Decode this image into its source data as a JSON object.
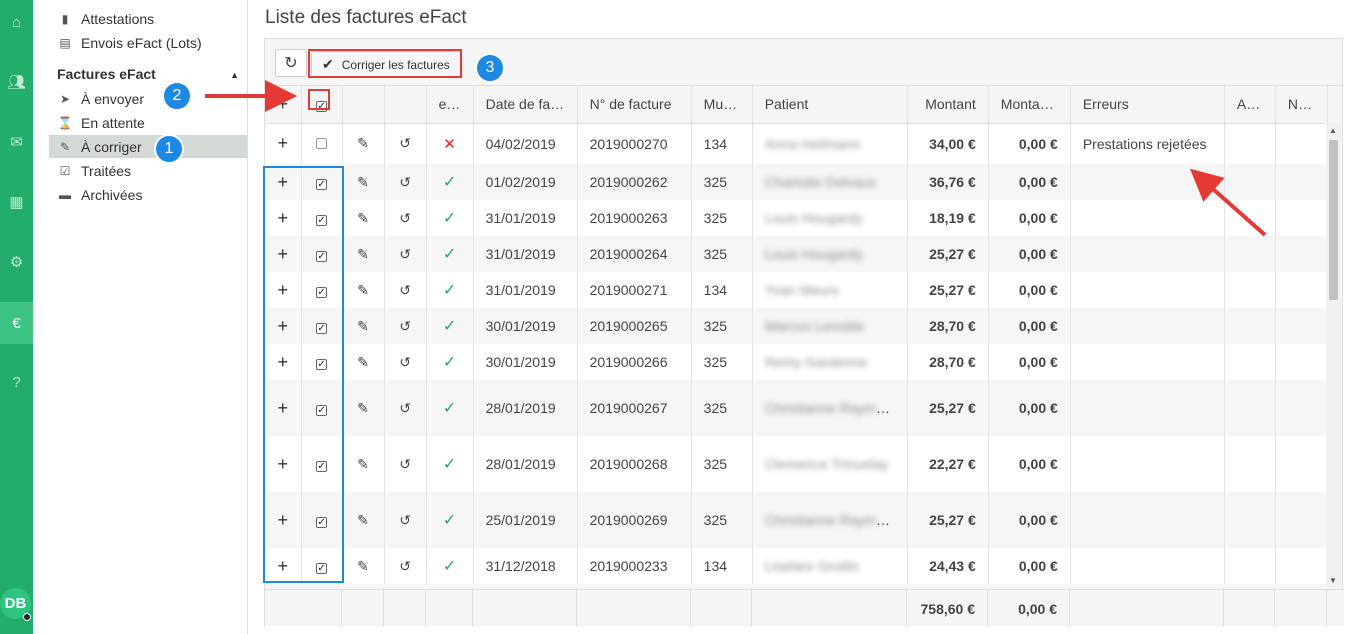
{
  "rail": {
    "icons": [
      "home-icon",
      "users-icon",
      "mail-icon",
      "calendar-icon",
      "gear-icon",
      "euro-icon",
      "help-icon"
    ],
    "avatar_initials": "DB",
    "accent_color": "#22ad6a"
  },
  "sidebar": {
    "items_top": [
      {
        "label": "Attestations",
        "icon": "file-icon"
      },
      {
        "label": "Envois eFact (Lots)",
        "icon": "list-file-icon"
      }
    ],
    "section_title": "Factures eFact",
    "section_items": [
      {
        "label": "À envoyer",
        "icon": "send-icon"
      },
      {
        "label": "En attente",
        "icon": "hourglass-icon"
      },
      {
        "label": "À corriger",
        "icon": "edit-icon",
        "active": true
      },
      {
        "label": "Traitées",
        "icon": "clipboard-check-icon"
      },
      {
        "label": "Archivées",
        "icon": "archive-icon"
      }
    ]
  },
  "main": {
    "title": "Liste des factures eFact",
    "toolbar": {
      "corriger_label": "Corriger les factures"
    },
    "columns": [
      "e…",
      "Date de fa…",
      "N° de facture",
      "Mut…",
      "Patient",
      "Montant",
      "Monta…",
      "Erreurs",
      "As…",
      "N…"
    ],
    "rows": [
      {
        "checked": false,
        "status": "error",
        "date": "04/02/2019",
        "num": "2019000270",
        "mut": "134",
        "patient": "Anna Heilmann",
        "montant": "34,00 €",
        "montant2": "0,00 €",
        "erreurs": "Prestations rejetées"
      },
      {
        "checked": true,
        "status": "ok",
        "date": "01/02/2019",
        "num": "2019000262",
        "mut": "325",
        "patient": "Charlotte Delvaux",
        "montant": "36,76 €",
        "montant2": "0,00 €",
        "erreurs": ""
      },
      {
        "checked": true,
        "status": "ok",
        "date": "31/01/2019",
        "num": "2019000263",
        "mut": "325",
        "patient": "Louis Hougardy",
        "montant": "18,19 €",
        "montant2": "0,00 €",
        "erreurs": ""
      },
      {
        "checked": true,
        "status": "ok",
        "date": "31/01/2019",
        "num": "2019000264",
        "mut": "325",
        "patient": "Louis Hougardy",
        "montant": "25,27 €",
        "montant2": "0,00 €",
        "erreurs": ""
      },
      {
        "checked": true,
        "status": "ok",
        "date": "31/01/2019",
        "num": "2019000271",
        "mut": "134",
        "patient": "Yvan Meurs",
        "montant": "25,27 €",
        "montant2": "0,00 €",
        "erreurs": ""
      },
      {
        "checked": true,
        "status": "ok",
        "date": "30/01/2019",
        "num": "2019000265",
        "mut": "325",
        "patient": "Marcus Lenoble",
        "montant": "28,70 €",
        "montant2": "0,00 €",
        "erreurs": ""
      },
      {
        "checked": true,
        "status": "ok",
        "date": "30/01/2019",
        "num": "2019000266",
        "mut": "325",
        "patient": "Remy Gardenne",
        "montant": "28,70 €",
        "montant2": "0,00 €",
        "erreurs": ""
      },
      {
        "checked": true,
        "status": "ok",
        "date": "28/01/2019",
        "num": "2019000267",
        "mut": "325",
        "patient": "Christianne Raymonde C Libeke",
        "montant": "25,27 €",
        "montant2": "0,00 €",
        "erreurs": ""
      },
      {
        "checked": true,
        "status": "ok",
        "date": "28/01/2019",
        "num": "2019000268",
        "mut": "325",
        "patient": "Clemence Trinuelay",
        "montant": "22,27 €",
        "montant2": "0,00 €",
        "erreurs": ""
      },
      {
        "checked": true,
        "status": "ok",
        "date": "25/01/2019",
        "num": "2019000269",
        "mut": "325",
        "patient": "Christianne Raymonde C Libeke",
        "montant": "25,27 €",
        "montant2": "0,00 €",
        "erreurs": ""
      },
      {
        "checked": true,
        "status": "ok",
        "date": "31/12/2018",
        "num": "2019000233",
        "mut": "134",
        "patient": "Liselare Grotlin",
        "montant": "24,43 €",
        "montant2": "0,00 €",
        "erreurs": ""
      }
    ],
    "totals": {
      "montant": "758,60 €",
      "montant2": "0,00 €"
    }
  },
  "annotations": {
    "badge1": "1",
    "badge2": "2",
    "badge3": "3"
  }
}
